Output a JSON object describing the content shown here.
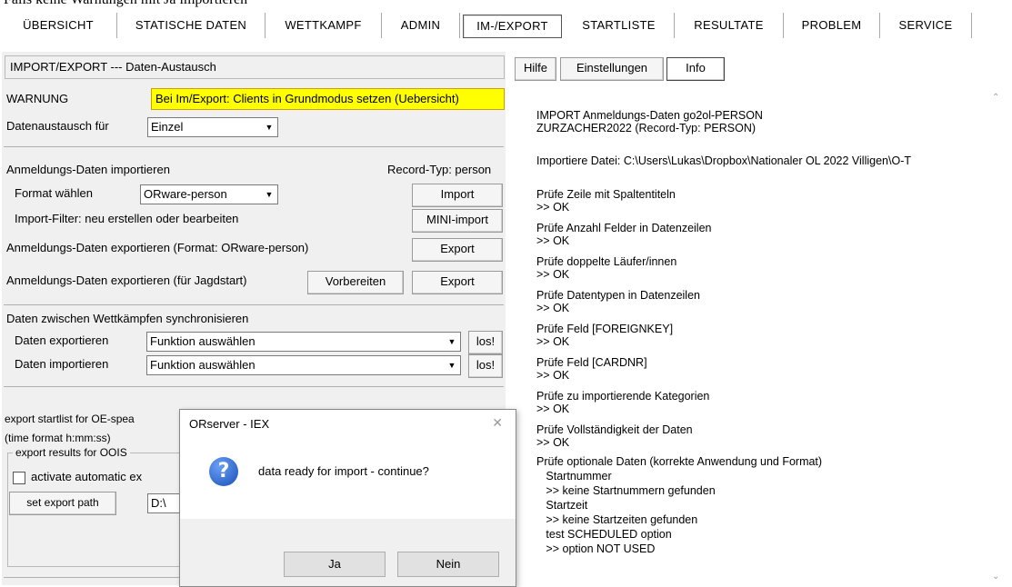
{
  "caption": "Falls keine Warnungen mit Ja importieren",
  "tabs": [
    "ÜBERSICHT",
    "STATISCHE DATEN",
    "WETTKAMPF",
    "ADMIN",
    "IM-/EXPORT",
    "STARTLISTE",
    "RESULTATE",
    "PROBLEM",
    "SERVICE"
  ],
  "active_tab": "IM-/EXPORT",
  "left": {
    "header": "IMPORT/EXPORT --- Daten-Austausch",
    "warning_label": "WARNUNG",
    "warning_text": "Bei Im/Export: Clients in Grundmodus setzen (Uebersicht)",
    "exchange_label": "Datenaustausch für",
    "exchange_value": "Einzel",
    "import_section_label": "Anmeldungs-Daten importieren",
    "record_type": "Record-Typ: person",
    "format_label": "Format wählen",
    "format_value": "ORware-person",
    "import_button": "Import",
    "filter_label": "Import-Filter: neu erstellen oder bearbeiten",
    "mini_import_button": "MINI-import",
    "export_label": "Anmeldungs-Daten exportieren  (Format: ORware-person)",
    "export_button": "Export",
    "export_hunt_label": "Anmeldungs-Daten exportieren (für Jagdstart)",
    "prepare_button": "Vorbereiten",
    "export_hunt_button": "Export",
    "sync_label": "Daten zwischen Wettkämpfen synchronisieren",
    "sync_export_label": "Daten exportieren",
    "sync_export_value": "Funktion auswählen",
    "sync_export_go": "los!",
    "sync_import_label": "Daten importieren",
    "sync_import_value": "Funktion auswählen",
    "sync_import_go": "los!",
    "oe_label": "export startlist for OE-spea",
    "time_format_label": "(time format h:mm:ss)",
    "oois_label": "export results for OOIS",
    "activate_label": "activate automatic ex",
    "set_path_button": "set export path",
    "path_value": "D:\\"
  },
  "right": {
    "tabs": [
      "Hilfe",
      "Einstellungen",
      "Info"
    ],
    "log": [
      "IMPORT Anmeldungs-Daten  go2ol-PERSON",
      "ZURZACHER2022  (Record-Typ: PERSON)",
      "",
      "Importiere Datei: C:\\Users\\Lukas\\Dropbox\\Nationaler OL 2022 Villigen\\O-T",
      "",
      "Prüfe Zeile mit Spaltentiteln",
      ">> OK",
      "Prüfe Anzahl Felder in Datenzeilen",
      ">> OK",
      "Prüfe doppelte Läufer/innen",
      ">> OK",
      "Prüfe Datentypen in Datenzeilen",
      ">> OK",
      "Prüfe Feld [FOREIGNKEY]",
      ">> OK",
      "Prüfe Feld [CARDNR]",
      ">> OK",
      "Prüfe zu importierende Kategorien",
      ">> OK",
      "Prüfe Vollständigkeit der Daten",
      ">> OK",
      "Prüfe optionale Daten (korrekte Anwendung und Format)",
      "   Startnummer",
      "   >> keine Startnummern gefunden",
      "   Startzeit",
      "   >> keine Startzeiten gefunden",
      "   test SCHEDULED option",
      "   >> option NOT USED"
    ]
  },
  "dialog": {
    "title": "ORserver - IEX",
    "close": "✕",
    "message": "data ready for import - continue?",
    "yes": "Ja",
    "no": "Nein"
  }
}
